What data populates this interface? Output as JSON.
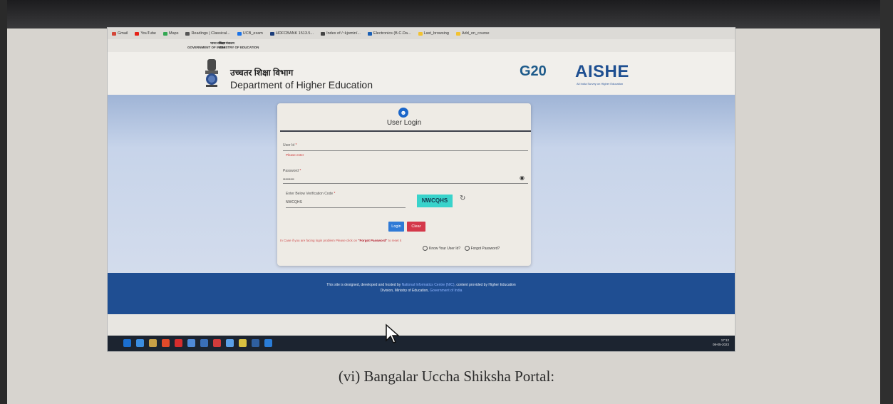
{
  "browser": {
    "bookmarks": [
      {
        "label": "Gmail",
        "color": "#d44638"
      },
      {
        "label": "YouTube",
        "color": "#e62117"
      },
      {
        "label": "Maps",
        "color": "#34a853"
      },
      {
        "label": "Readings | Classical...",
        "color": "#555555"
      },
      {
        "label": "UCB_exam",
        "color": "#1a73e8"
      },
      {
        "label": "HDFCBANK 1513.5...",
        "color": "#1c3d7a"
      },
      {
        "label": "Index of /~kjomin/...",
        "color": "#444444"
      },
      {
        "label": "Electronics (B.C.Da...",
        "color": "#1a5fb4"
      },
      {
        "label": "Last_browsing",
        "color": "#f2c230"
      },
      {
        "label": "Add_on_course",
        "color": "#f2c230"
      }
    ]
  },
  "gov": {
    "left_line1": "भारत सरकार",
    "left_line2": "GOVERNMENT OF INDIA",
    "right_line1": "शिक्षा मंत्रालय",
    "right_line2": "MINISTRY OF EDUCATION"
  },
  "header": {
    "dept_hindi": "उच्चतर शिक्षा विभाग",
    "dept_english": "Department of Higher Education",
    "g20": "G20",
    "aishe": "AISHE",
    "aishe_sub": "All India Survey on Higher Education"
  },
  "login": {
    "title": "User Login",
    "user_id_label": "User Id",
    "user_id_error": "Please enter",
    "password_label": "Password",
    "password_value": "•••••••••",
    "captcha_label": "Enter Below Verification Code",
    "captcha_input_value": "NWCQHS",
    "captcha_code": "NWCQHS",
    "login_button": "Login",
    "clear_button": "Clear",
    "help_text": "In Case if you are facing login problem Please click on ",
    "help_link": "\"Forgot Password\"",
    "help_suffix": " to reset it",
    "know_user_id": "Know Your User Id?",
    "forgot_password": "Forgot Password?"
  },
  "footer": {
    "line1_prefix": "This site is designed, developed and hosted by ",
    "line1_link": "National Informatics Centre (NIC)",
    "line1_suffix": ", content provided by Higher Education",
    "line2_prefix": "Division, Ministry of Education, ",
    "line2_link": "Government of India"
  },
  "taskbar": {
    "time": "17:12",
    "date": "08-05-2023",
    "icons": [
      "#1b6fd0",
      "#3b8de0",
      "#c8a046",
      "#e24a2a",
      "#d62d2d",
      "#4f8ad8",
      "#3a6fb8",
      "#d23b3b",
      "#5aa0e8",
      "#d9c040",
      "#2f5f9f",
      "#2a7dd8"
    ]
  },
  "caption": "(vi) Bangalar Uccha Shiksha Portal:"
}
